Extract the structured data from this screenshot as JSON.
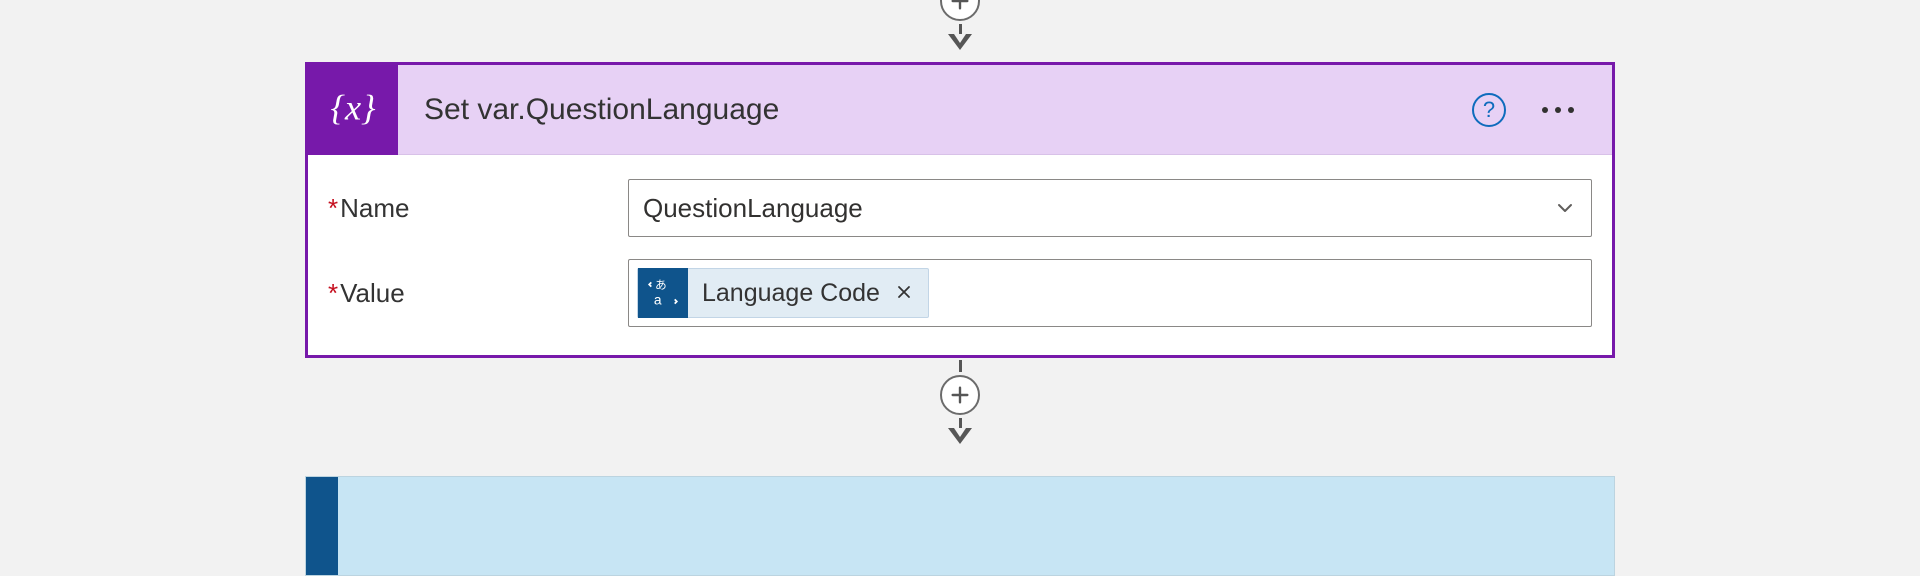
{
  "colors": {
    "accent_purple": "#7719aa",
    "header_fill": "#e7d1f5",
    "token_icon": "#0f548c",
    "help_blue": "#0f6cbd"
  },
  "action": {
    "title": "Set var.QuestionLanguage",
    "icon": "variable-icon",
    "fields": {
      "name": {
        "label": "Name",
        "required": true,
        "value": "QuestionLanguage"
      },
      "value": {
        "label": "Value",
        "required": true,
        "tokens": [
          {
            "icon": "translate-icon",
            "label": "Language Code"
          }
        ]
      }
    }
  },
  "connectors": {
    "add_label": "Add step"
  }
}
